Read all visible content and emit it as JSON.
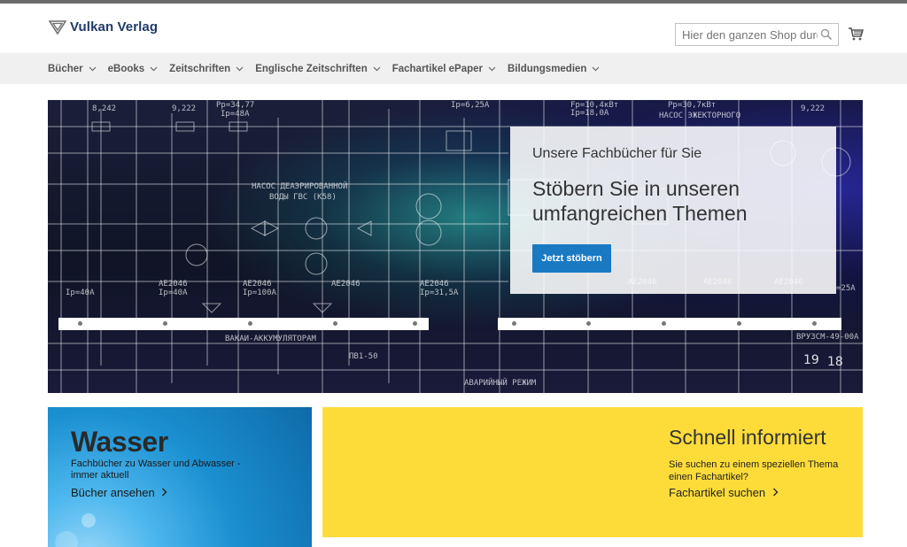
{
  "header": {
    "logo_text": "Vulkan Verlag",
    "search_placeholder": "Hier den ganzen Shop durchsuchen..."
  },
  "nav": {
    "items": [
      {
        "label": "Bücher"
      },
      {
        "label": "eBooks"
      },
      {
        "label": "Zeitschriften"
      },
      {
        "label": "Englische Zeitschriften"
      },
      {
        "label": "Fachartikel ePaper"
      },
      {
        "label": "Bildungsmedien"
      }
    ]
  },
  "hero": {
    "subtitle": "Unsere Fachbücher für Sie",
    "title": "Stöbern Sie in unseren umfangreichen Themen",
    "button_label": "Jetzt stöbern"
  },
  "tiles": {
    "wasser": {
      "title": "Wasser",
      "description": "Fachbücher zu Wasser und Abwasser - immer aktuell",
      "link": "Bücher ansehen"
    },
    "schnell": {
      "title": "Schnell informiert",
      "description": "Sie suchen zu einem speziellen Thema einen Fachartikel?",
      "link": "Fachartikel suchen"
    }
  },
  "colors": {
    "brand_blue": "#1f3a68",
    "button_blue": "#1979c3",
    "yellow_tile": "#fddc3a",
    "nav_bg": "#f0f0f0"
  }
}
